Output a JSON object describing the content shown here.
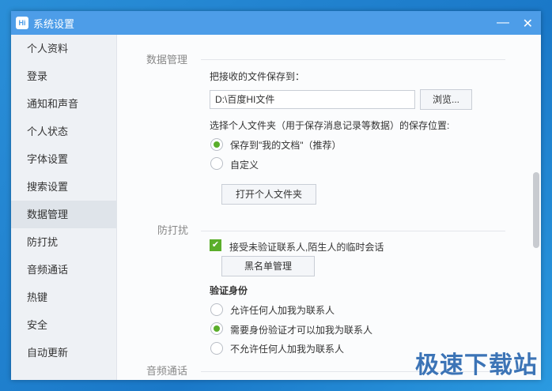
{
  "window": {
    "title": "系统设置",
    "logo": "Hi"
  },
  "sidebar": {
    "items": [
      {
        "label": "个人资料"
      },
      {
        "label": "登录"
      },
      {
        "label": "通知和声音"
      },
      {
        "label": "个人状态"
      },
      {
        "label": "字体设置"
      },
      {
        "label": "搜索设置"
      },
      {
        "label": "数据管理",
        "selected": true
      },
      {
        "label": "防打扰"
      },
      {
        "label": "音频通话"
      },
      {
        "label": "热键"
      },
      {
        "label": "安全"
      },
      {
        "label": "自动更新"
      }
    ]
  },
  "data_mgmt": {
    "heading": "数据管理",
    "save_label": "把接收的文件保存到：",
    "path_value": "D:\\百度HI文件",
    "browse": "浏览...",
    "folder_label": "选择个人文件夹（用于保存消息记录等数据）的保存位置:",
    "opt_docs": "保存到\"我的文档\"（推荐）",
    "opt_custom": "自定义",
    "open_folder": "打开个人文件夹"
  },
  "dnd": {
    "heading": "防打扰",
    "accept_label": "接受未验证联系人,陌生人的临时会话",
    "accept_checked": true,
    "blacklist": "黑名单管理",
    "verify_heading": "验证身份",
    "opt_any": "允许任何人加我为联系人",
    "opt_verify": "需要身份验证才可以加我为联系人",
    "opt_none": "不允许任何人加我为联系人"
  },
  "audio": {
    "heading": "音频通话"
  },
  "watermark": "极速下载站",
  "colors": {
    "titlebar": "#4d9de8",
    "accent_green": "#5aae2a"
  }
}
